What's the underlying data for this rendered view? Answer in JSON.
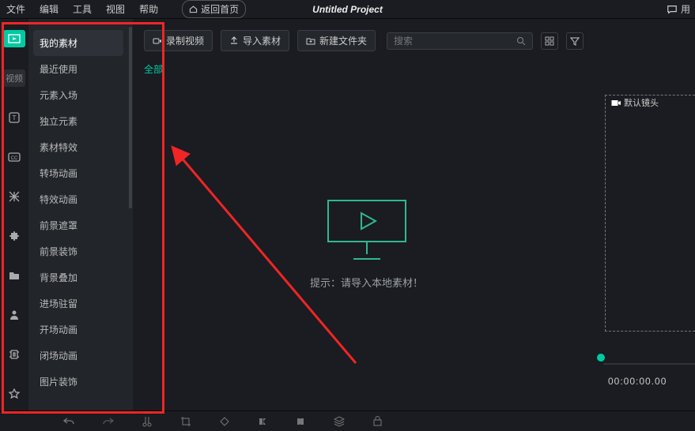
{
  "menu": {
    "file": "文件",
    "edit": "编辑",
    "tools": "工具",
    "view": "视图",
    "help": "帮助",
    "home": "返回首页",
    "title": "Untitled Project",
    "user": "用"
  },
  "toolstrip": {
    "video_label": "视频"
  },
  "categories": {
    "items": [
      "我的素材",
      "最近使用",
      "元素入场",
      "独立元素",
      "素材特效",
      "转场动画",
      "特效动画",
      "前景遮罩",
      "前景装饰",
      "背景叠加",
      "进场驻留",
      "开场动画",
      "闭场动画",
      "图片装饰"
    ]
  },
  "toolbar": {
    "record": "录制视频",
    "import": "导入素材",
    "newfolder": "新建文件夹",
    "search_ph": "搜索",
    "tab_all": "全部"
  },
  "empty": {
    "hint": "提示：请导入本地素材！"
  },
  "preview": {
    "default_camera": "默认镜头",
    "timecode": "00:00:00.00"
  }
}
